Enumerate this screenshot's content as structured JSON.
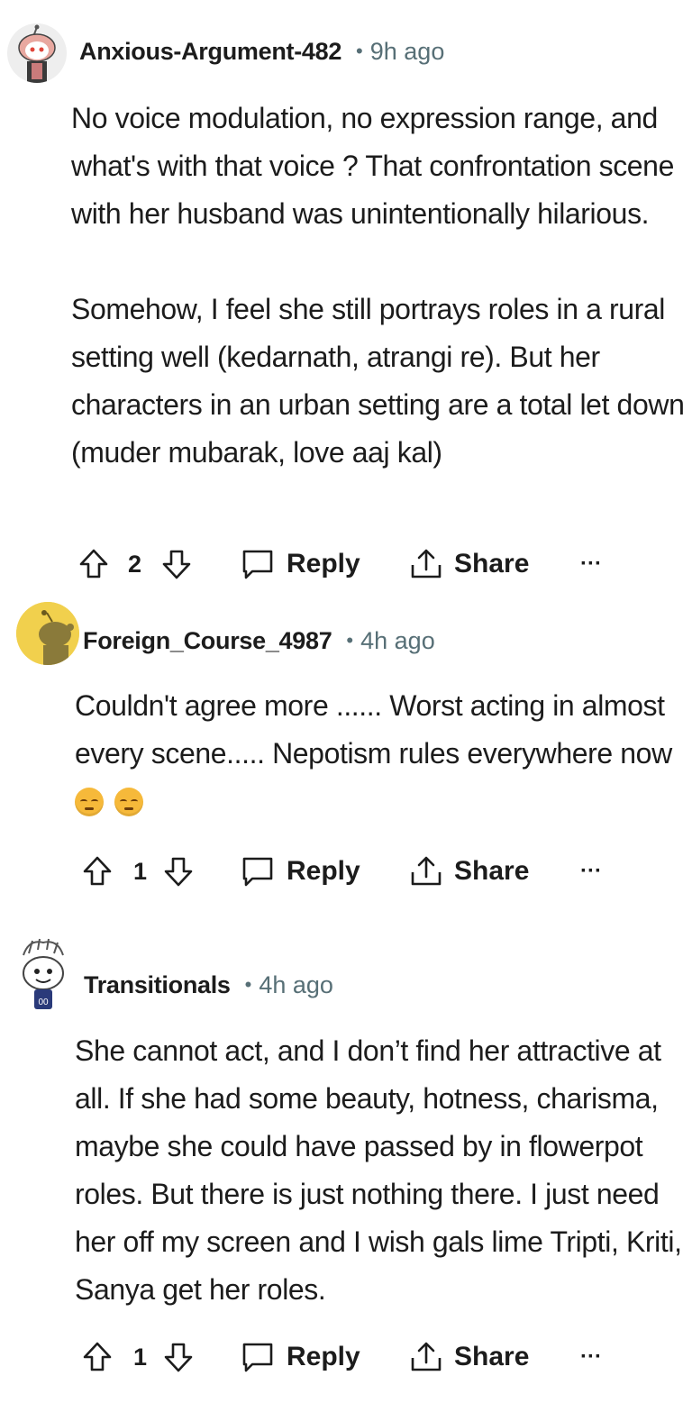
{
  "comments": [
    {
      "username": "Anxious-Argument-482",
      "time": "9h ago",
      "paragraphs": [
        "No voice modulation, no expression range, and what's with that voice ? That confrontation scene with her husband was unintentionally hilarious.",
        "Somehow, I feel she still portrays roles in a rural setting well (kedarnath, atrangi re). But her characters in an urban setting are a total let down (muder mubarak, love aaj kal)"
      ],
      "votes": "2",
      "reply_label": "Reply",
      "share_label": "Share",
      "more_label": "···"
    },
    {
      "username": "Foreign_Course_4987",
      "time": "4h ago",
      "paragraphs": [
        "Couldn't agree more ...... Worst acting in almost every scene..... Nepotism rules everywhere now"
      ],
      "emoji": [
        "pensive-face-emoji",
        "pensive-face-emoji"
      ],
      "votes": "1",
      "reply_label": "Reply",
      "share_label": "Share",
      "more_label": "···"
    },
    {
      "username": "Transitionals",
      "time": "4h ago",
      "paragraphs": [
        "She cannot act, and I don’t find her attractive at all. If she had some beauty, hotness, charisma, maybe she could have passed by in flowerpot roles. But there is just nothing there. I just need her off my screen and I wish gals lime Tripti, Kriti, Sanya get her roles."
      ],
      "votes": "1",
      "reply_label": "Reply",
      "share_label": "Share",
      "more_label": "···"
    }
  ],
  "colors": {
    "text": "#1c1c1c",
    "meta": "#576f76",
    "avatar2_bg": "#f1d04d",
    "emoji": "#f6b93a"
  },
  "icons": [
    "upvote-icon",
    "downvote-icon",
    "comment-bubble-icon",
    "share-icon",
    "more-icon"
  ]
}
